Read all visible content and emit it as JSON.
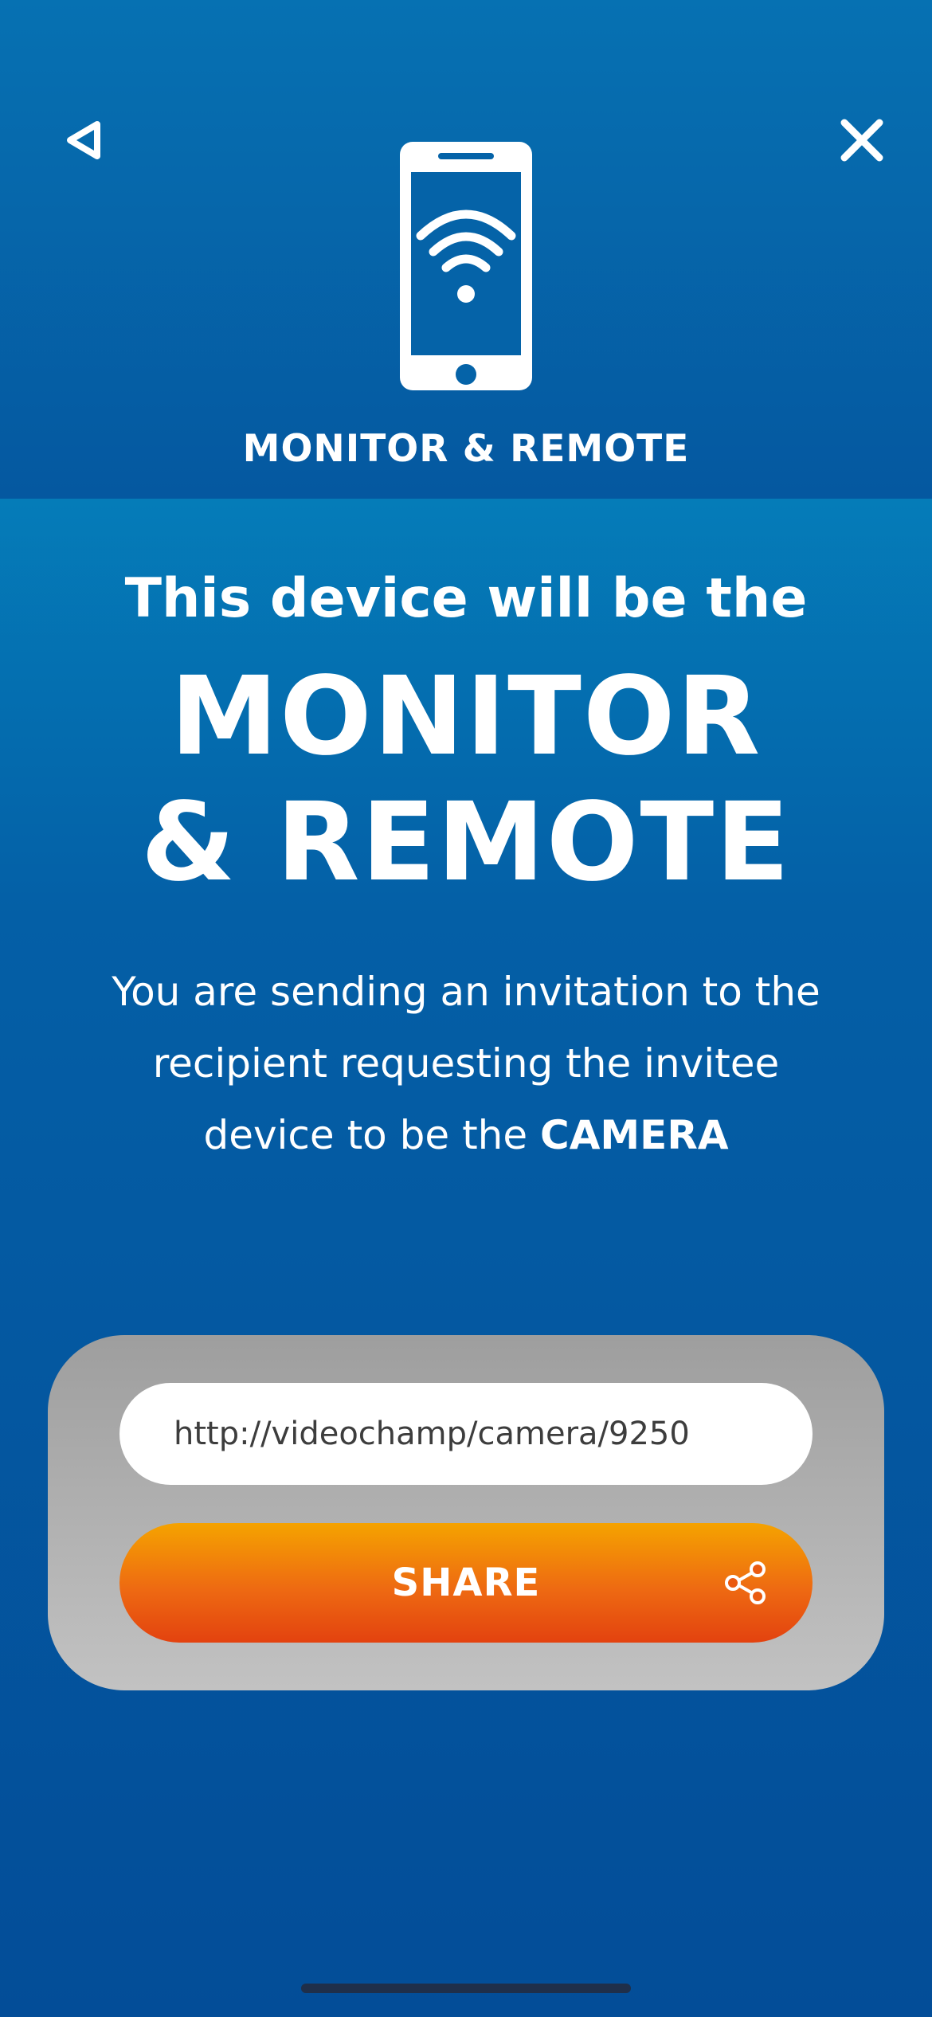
{
  "header": {
    "title": "MONITOR & REMOTE",
    "back_icon": "back-triangle-icon",
    "close_icon": "close-icon",
    "device_icon": "phone-wifi-icon"
  },
  "main": {
    "intro": "This device will be the",
    "role_line1": "MONITOR",
    "role_line2": "& REMOTE",
    "description": "You are sending an invitation to the recipient requesting the invitee device to be the",
    "description_emphasis": "CAMERA"
  },
  "share_card": {
    "link": "http://videochamp/camera/9250",
    "share_label": "SHARE",
    "share_icon": "share-icon"
  },
  "colors": {
    "header_bg": "#0565a9",
    "body_bg": "#0583bd",
    "card_bg": "#b0b0b0",
    "share_gradient_top": "#f5a300",
    "share_gradient_bottom": "#e3420f"
  }
}
